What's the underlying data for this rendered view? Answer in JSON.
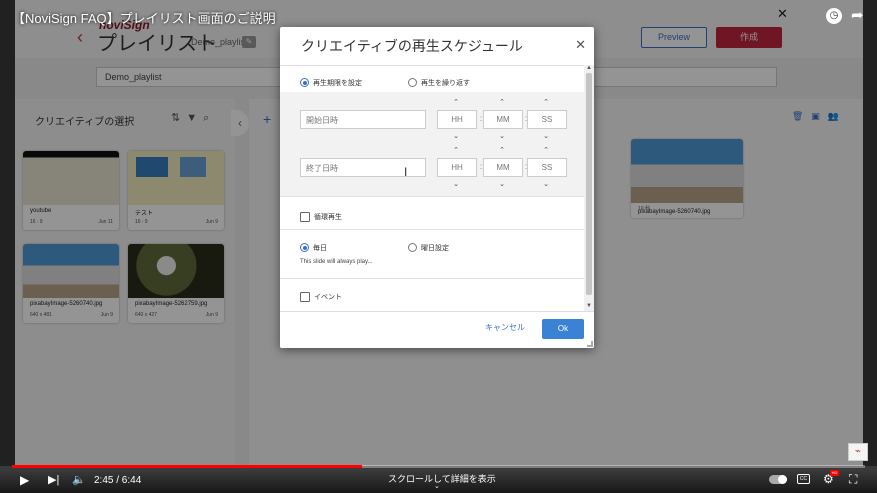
{
  "video": {
    "title": "【NoviSign FAQ】プレイリスト画面のご説明",
    "time": "2:45 / 6:44",
    "progress_fraction": 0.41,
    "scroll_hint": "スクロールして詳細を表示",
    "watermark": "⌁",
    "hd_badge": "HD"
  },
  "app": {
    "logo": "noviSign",
    "page_title": "プレイリスト",
    "playlist_name_label": "Demo_playlist *",
    "preview_button": "Preview",
    "create_button": "作成",
    "playlist_name_value": "Demo_playlist",
    "left_panel_title": "クリエイティブの選択",
    "add_label": "+",
    "colors": {
      "accent": "#3a70c8",
      "brand": "#c0253e"
    },
    "cards": [
      {
        "name": "youtube",
        "meta": "16 : 9",
        "date": "Jun 11"
      },
      {
        "name": "テスト",
        "meta": "16 : 9",
        "date": "Jun 9"
      },
      {
        "name": "pixabayImage-5260740.jpg",
        "meta": "640 x 481",
        "date": "Jun 9"
      },
      {
        "name": "pixabayImage-5262759.jpg",
        "meta": "640 x 427",
        "date": "Jun 9"
      }
    ],
    "right_card": {
      "name": "pixabayImage-5260740.jpg",
      "meta": "10 秒"
    }
  },
  "dialog": {
    "title": "クリエイティブの再生スケジュール",
    "radio_period": "再生期限を設定",
    "radio_repeat": "再生を繰り返す",
    "start_placeholder": "開始日時",
    "end_placeholder": "終了日時",
    "hh": "HH",
    "mm": "MM",
    "ss": "SS",
    "loop_label": "循環再生",
    "radio_daily": "毎日",
    "radio_weekday": "曜日設定",
    "note": "This slide will always play...",
    "event_label": "イベント",
    "cancel": "キャンセル",
    "ok": "Ok"
  }
}
